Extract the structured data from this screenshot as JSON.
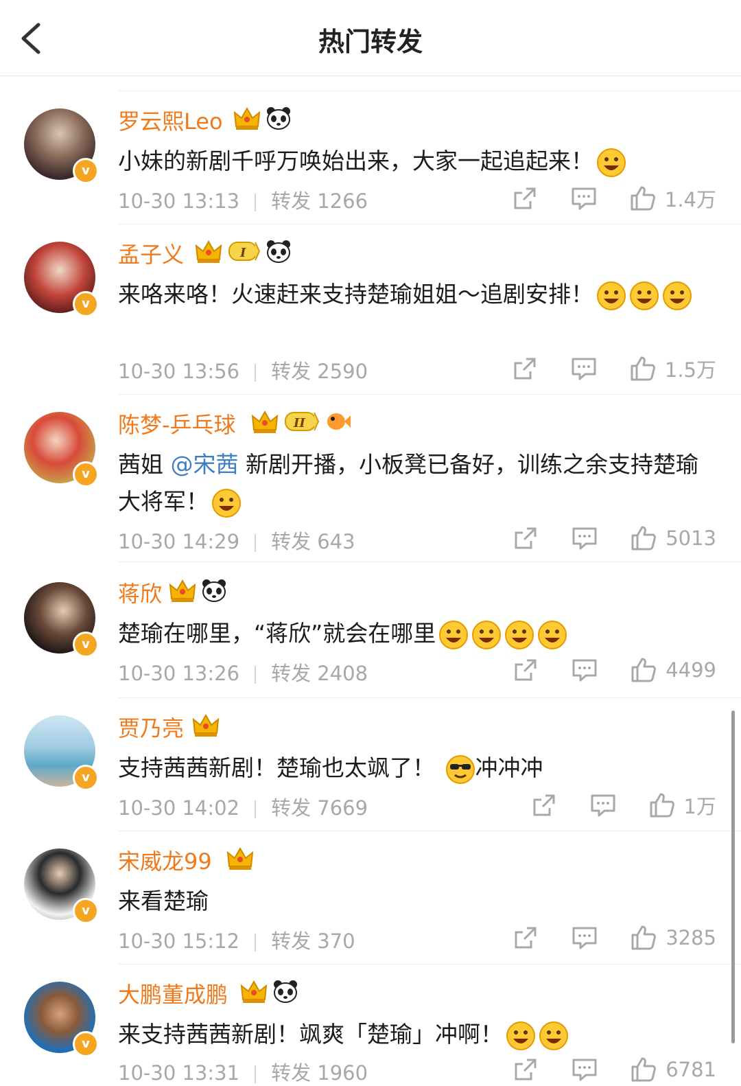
{
  "header": {
    "title": "热门转发"
  },
  "posts": [
    {
      "name": "罗云熙Leo",
      "text": "小妹的新剧千呼万唤始出来，大家一起追起来！",
      "time": "10-30 13:13",
      "repost_label": "转发 1266",
      "likes": "1.4万"
    },
    {
      "name": "孟子义",
      "text": "来咯来咯！火速赶来支持楚瑜姐姐～追剧安排！",
      "time": "10-30 13:56",
      "repost_label": "转发 2590",
      "likes": "1.5万"
    },
    {
      "name": "陈梦-乒乓球",
      "text_pre": "茜姐 ",
      "mention": "@宋茜",
      "text_post": " 新剧开播，小板凳已备好，训练之余支持楚瑜大将军！",
      "time": "10-30 14:29",
      "repost_label": "转发 643",
      "likes": "5013"
    },
    {
      "name": "蒋欣",
      "text": "楚瑜在哪里，“蒋欣”就会在哪里",
      "time": "10-30 13:26",
      "repost_label": "转发 2408",
      "likes": "4499"
    },
    {
      "name": "贾乃亮",
      "text": "支持茜茜新剧！楚瑜也太飒了！",
      "text_after": "冲冲冲",
      "time": "10-30 14:02",
      "repost_label": "转发 7669",
      "likes": "1万"
    },
    {
      "name": "宋威龙99",
      "text": "来看楚瑜",
      "time": "10-30 15:12",
      "repost_label": "转发 370",
      "likes": "3285"
    },
    {
      "name": "大鹏董成鹏",
      "text": "来支持茜茜新剧！飒爽「楚瑜」冲啊！",
      "time": "10-30 13:31",
      "repost_label": "转发 1960",
      "likes": "6781"
    }
  ],
  "colors": {
    "name": "#f07a1b",
    "mention": "#3d7ec4",
    "meta": "#a8a8a8",
    "vbadge": "#f4a623"
  }
}
